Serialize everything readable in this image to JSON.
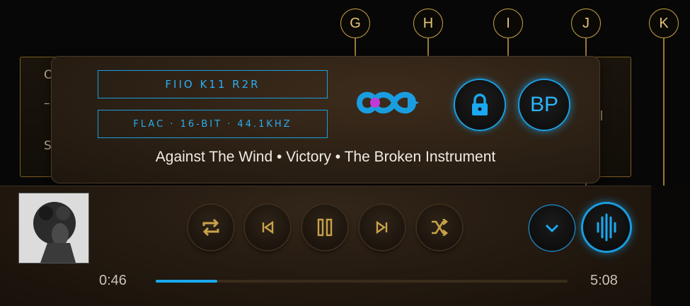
{
  "background_panel": {
    "chars": [
      "O",
      "–",
      "S"
    ]
  },
  "popup": {
    "device": "FIIO K11 R2R",
    "format": "FLAC · 16-BIT · 44.1KHZ",
    "track_info": "Against The Wind • Victory • The Broken Instrument",
    "bitperfect_label": "BP"
  },
  "callouts": [
    "G",
    "H",
    "I",
    "J",
    "K"
  ],
  "player": {
    "elapsed": "0:46",
    "duration": "5:08",
    "progress_fraction": 0.15
  },
  "icons": {
    "dac_logo": "infinity-play-icon",
    "lock": "lock-icon",
    "collapse": "chevron-down-icon",
    "visualizer": "waveform-icon",
    "repeat": "repeat-icon",
    "prev": "skip-previous-icon",
    "pause": "pause-icon",
    "next": "skip-next-icon",
    "shuffle": "shuffle-icon"
  },
  "colors": {
    "accent_blue": "#1a9de0",
    "gold": "#c9a24a",
    "logo_purple": "#c03ad8"
  }
}
